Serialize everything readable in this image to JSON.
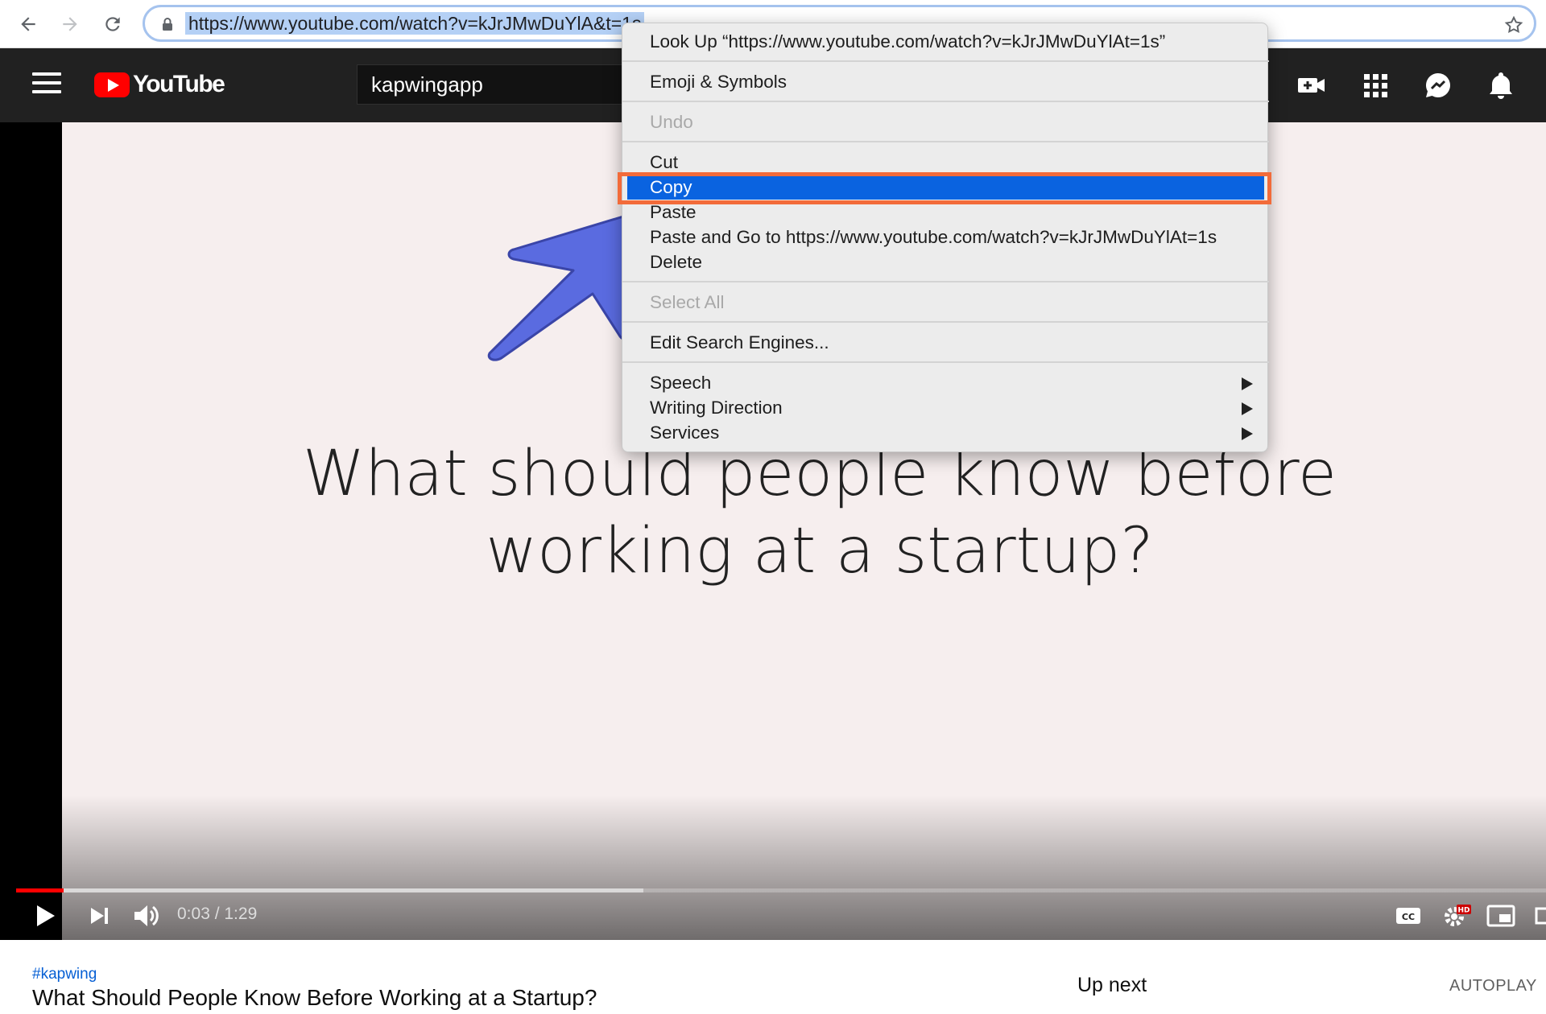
{
  "browser": {
    "url": "https://www.youtube.com/watch?v=kJrJMwDuYlA&t=1s"
  },
  "youtube": {
    "logo_text": "YouTube",
    "search_value": "kapwingapp"
  },
  "video": {
    "title_line_1": "What should people know before",
    "title_line_2": "working at a startup?",
    "time": "0:03 / 1:29",
    "progress_played": 0.031,
    "progress_buffered": 0.41,
    "hd_badge": "HD"
  },
  "below_video": {
    "hashtag": "#kapwing",
    "title": "What Should People Know Before Working at a Startup?",
    "up_next": "Up next",
    "autoplay": "AUTOPLAY"
  },
  "context_menu": {
    "items": [
      {
        "label": "Look Up “https://www.youtube.com/watch?v=kJrJMwDuYlAt=1s”"
      },
      {
        "label": "Emoji & Symbols"
      },
      {
        "label": "Undo"
      },
      {
        "label": "Cut"
      },
      {
        "label": "Copy"
      },
      {
        "label": "Paste"
      },
      {
        "label": "Paste and Go to https://www.youtube.com/watch?v=kJrJMwDuYlAt=1s"
      },
      {
        "label": "Delete"
      },
      {
        "label": "Select All"
      },
      {
        "label": "Edit Search Engines..."
      },
      {
        "label": "Speech"
      },
      {
        "label": "Writing Direction"
      },
      {
        "label": "Services"
      }
    ]
  },
  "colors": {
    "highlight_box": "#f26b3a",
    "selected_item": "#0a63e0",
    "annotation_arrow": "#5a6be0",
    "youtube_red": "#ff0000"
  }
}
